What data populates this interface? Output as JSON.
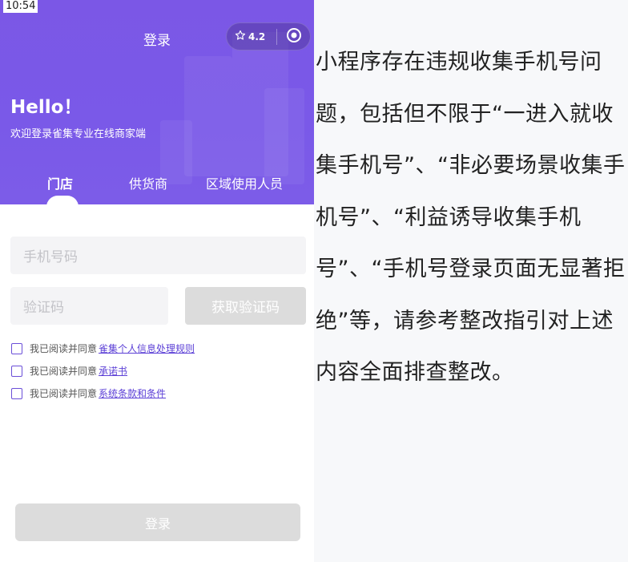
{
  "status_bar": {
    "time": "10:54"
  },
  "nav": {
    "title": "登录",
    "rating": "4.2"
  },
  "hero": {
    "greeting": "Hello！",
    "subtitle": "欢迎登录雀集专业在线商家端"
  },
  "tabs": [
    {
      "label": "门店",
      "active": true
    },
    {
      "label": "供货商",
      "active": false
    },
    {
      "label": "区域使用人员",
      "active": false
    }
  ],
  "form": {
    "phone_placeholder": "手机号码",
    "code_placeholder": "验证码",
    "get_code_label": "获取验证码",
    "agreements": [
      {
        "prefix": "我已阅读并同意",
        "link": "雀集个人信息处理规则"
      },
      {
        "prefix": "我已阅读并同意",
        "link": "承诺书"
      },
      {
        "prefix": "我已阅读并同意",
        "link": "系统条款和条件"
      }
    ],
    "login_label": "登录"
  },
  "notice": {
    "text": "小程序存在违规收集手机号问题，包括但不限于“一进入就收集手机号”、“非必要场景收集手机号”、“利益诱导收集手机号”、“手机号登录页面无显著拒绝”等，请参考整改指引对上述内容全面排查整改。"
  },
  "colors": {
    "brand": "#7b57e6",
    "link": "#5b3fd6",
    "disabled": "#dcdcdc"
  }
}
